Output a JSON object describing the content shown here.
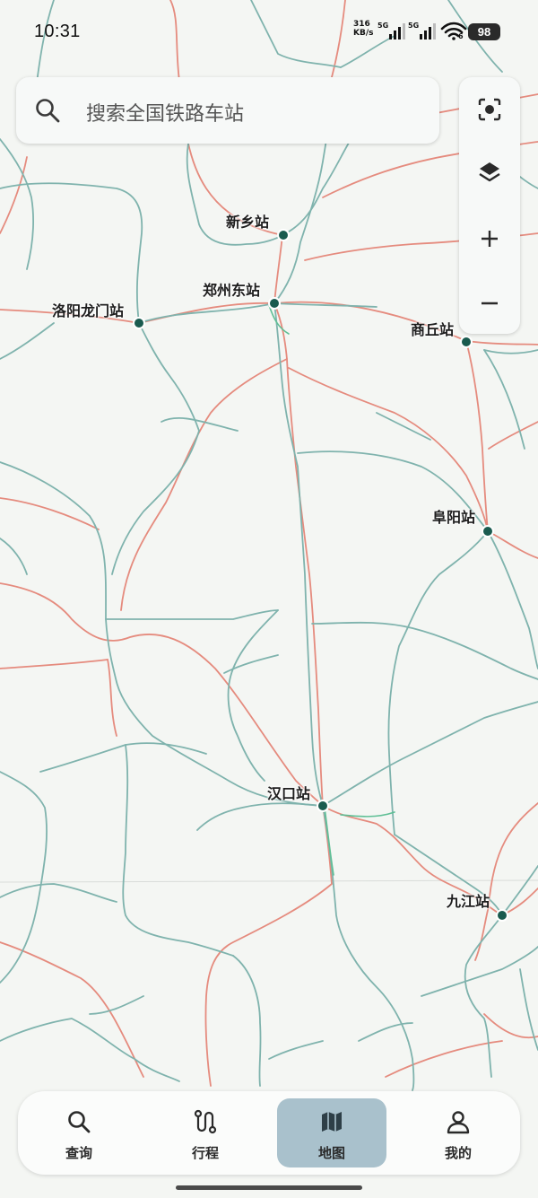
{
  "status_bar": {
    "time": "10:31",
    "net_speed_value": "316",
    "net_speed_unit": "KB/s",
    "sim1": "5G",
    "sim2": "5G",
    "wifi_badge": "6",
    "battery": "98"
  },
  "search": {
    "placeholder": "搜索全国铁路车站"
  },
  "map_tools": {
    "locate_icon": "locate-icon",
    "layers_icon": "layers-icon",
    "zoom_in_icon": "plus-icon",
    "zoom_out_icon": "minus-icon"
  },
  "stations": [
    {
      "name": "新乡站"
    },
    {
      "name": "郑州东站"
    },
    {
      "name": "洛阳龙门站"
    },
    {
      "name": "商丘站"
    },
    {
      "name": "阜阳站"
    },
    {
      "name": "汉口站"
    },
    {
      "name": "九江站"
    }
  ],
  "nav": {
    "items": [
      {
        "label": "查询",
        "icon": "search-icon",
        "active": false
      },
      {
        "label": "行程",
        "icon": "route-icon",
        "active": false
      },
      {
        "label": "地图",
        "icon": "map-icon",
        "active": true
      },
      {
        "label": "我的",
        "icon": "person-icon",
        "active": false
      }
    ]
  },
  "colors": {
    "background": "#f4f6f3",
    "rail_conventional": "#7fb3ad",
    "rail_highspeed": "#e58b7e",
    "station": "#1a5b4f",
    "nav_active": "#a9c1cc"
  }
}
